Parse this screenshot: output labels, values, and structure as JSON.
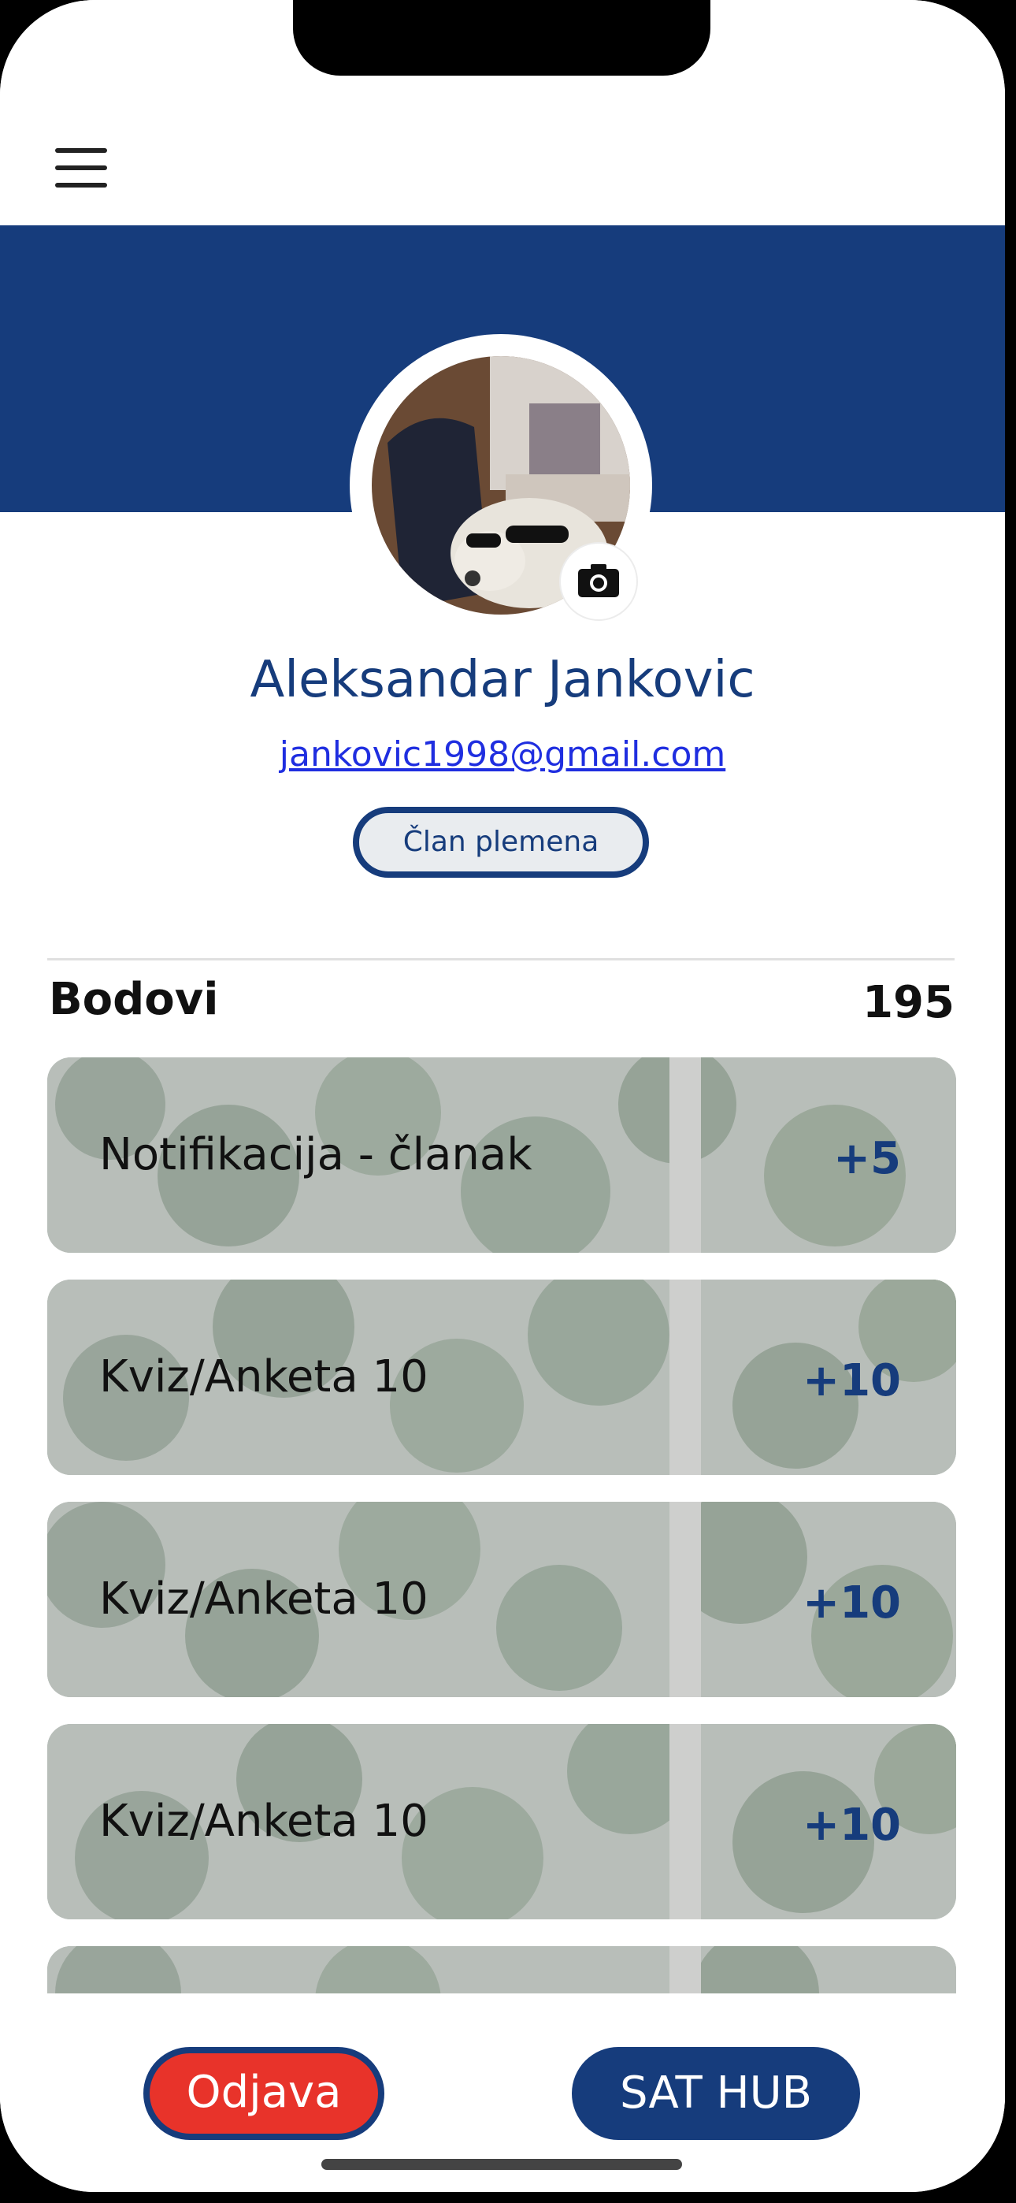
{
  "header": {
    "menu_icon": "hamburger-menu-icon"
  },
  "profile": {
    "name": "Aleksandar Jankovic",
    "email": "jankovic1998@gmail.com",
    "role": "Član plemena",
    "camera_icon": "camera-icon",
    "avatar_desc": "profile-photo"
  },
  "points": {
    "label": "Bodovi",
    "total": "195"
  },
  "activities": [
    {
      "title": "Notifikacija - članak",
      "points": "+5"
    },
    {
      "title": "Kviz/Anketa 10",
      "points": "+10"
    },
    {
      "title": "Kviz/Anketa 10",
      "points": "+10"
    },
    {
      "title": "Kviz/Anketa 10",
      "points": "+10"
    },
    {
      "title": "",
      "points": ""
    }
  ],
  "footer": {
    "logout_label": "Odjava",
    "hub_label": "SAT HUB"
  },
  "colors": {
    "brand": "#163c7c",
    "logout": "#e8332a",
    "link": "#1f2ee0"
  }
}
